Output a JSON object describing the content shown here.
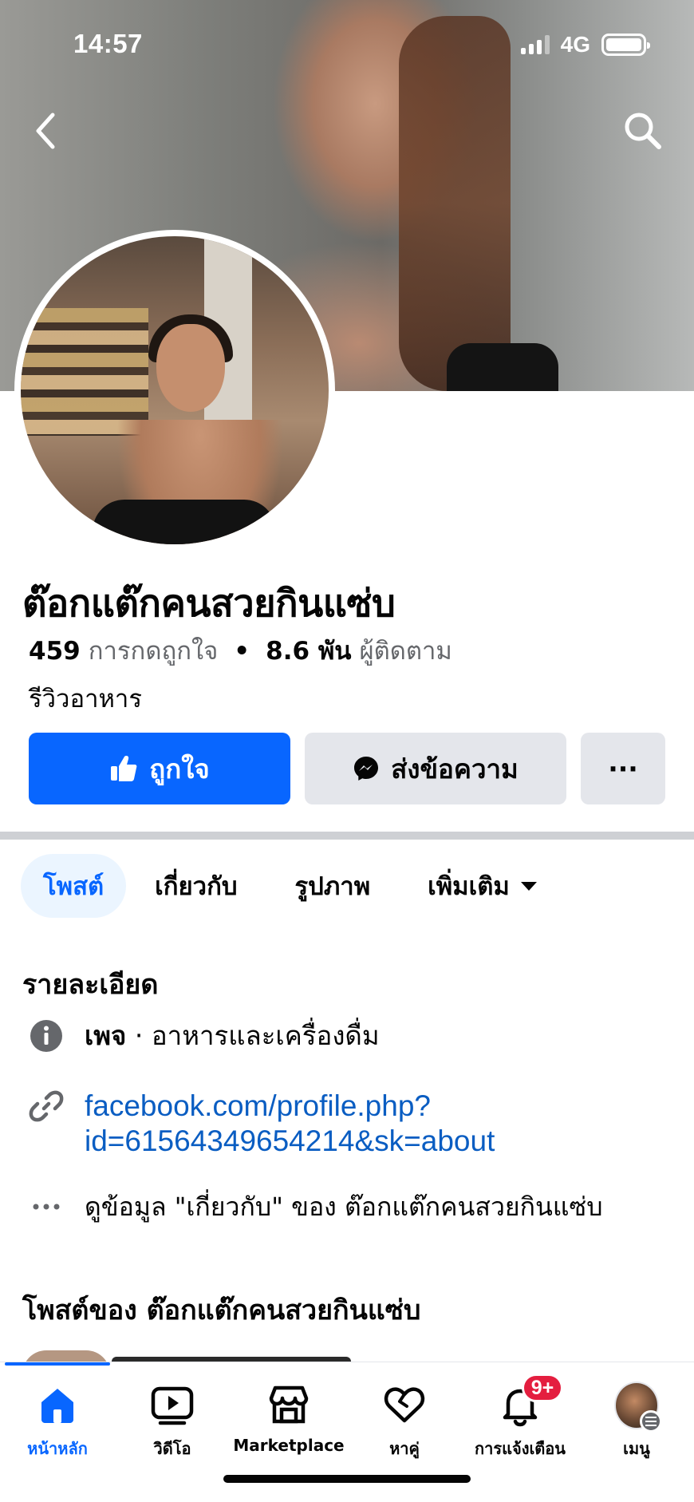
{
  "status_bar": {
    "time": "14:57",
    "network": "4G"
  },
  "page": {
    "name": "ต๊อกแต๊กคนสวยกินแซ่บ",
    "likes_count": "459",
    "likes_label": "การกดถูกใจ",
    "followers_count": "8.6 พัน",
    "followers_label": "ผู้ติดตาม",
    "category": "รีวิวอาหาร"
  },
  "actions": {
    "like_label": "ถูกใจ",
    "message_label": "ส่งข้อความ",
    "more_label": "···"
  },
  "tabs": [
    {
      "label": "โพสต์",
      "active": true
    },
    {
      "label": "เกี่ยวกับ",
      "active": false
    },
    {
      "label": "รูปภาพ",
      "active": false
    },
    {
      "label": "เพิ่มเติม",
      "active": false
    }
  ],
  "details": {
    "title": "รายละเอียด",
    "page_type_bold": "เพจ",
    "page_type_rest": " · อาหารและเครื่องดื่ม",
    "link_line1": "facebook.com/profile.php?",
    "link_line2": "id=61564349654214&sk=about",
    "see_about": "ดูข้อมูล \"เกี่ยวกับ\" ของ ต๊อกแต๊กคนสวยกินแซ่บ"
  },
  "posts_section": {
    "title": "โพสต์ของ ต๊อกแต๊กคนสวยกินแซ่บ"
  },
  "bottom_nav": [
    {
      "label": "หน้าหลัก",
      "icon": "home-icon",
      "active": true
    },
    {
      "label": "วิดีโอ",
      "icon": "video-icon",
      "active": false
    },
    {
      "label": "Marketplace",
      "icon": "marketplace-icon",
      "active": false
    },
    {
      "label": "หาคู่",
      "icon": "dating-heart-icon",
      "active": false
    },
    {
      "label": "การแจ้งเตือน",
      "icon": "bell-icon",
      "active": false,
      "badge": "9+"
    },
    {
      "label": "เมนู",
      "icon": "menu-avatar",
      "active": false
    }
  ],
  "colors": {
    "accent": "#0866ff",
    "link": "#0a5dc2",
    "badge": "#e41e3f",
    "button_grey": "#e4e6eb"
  }
}
